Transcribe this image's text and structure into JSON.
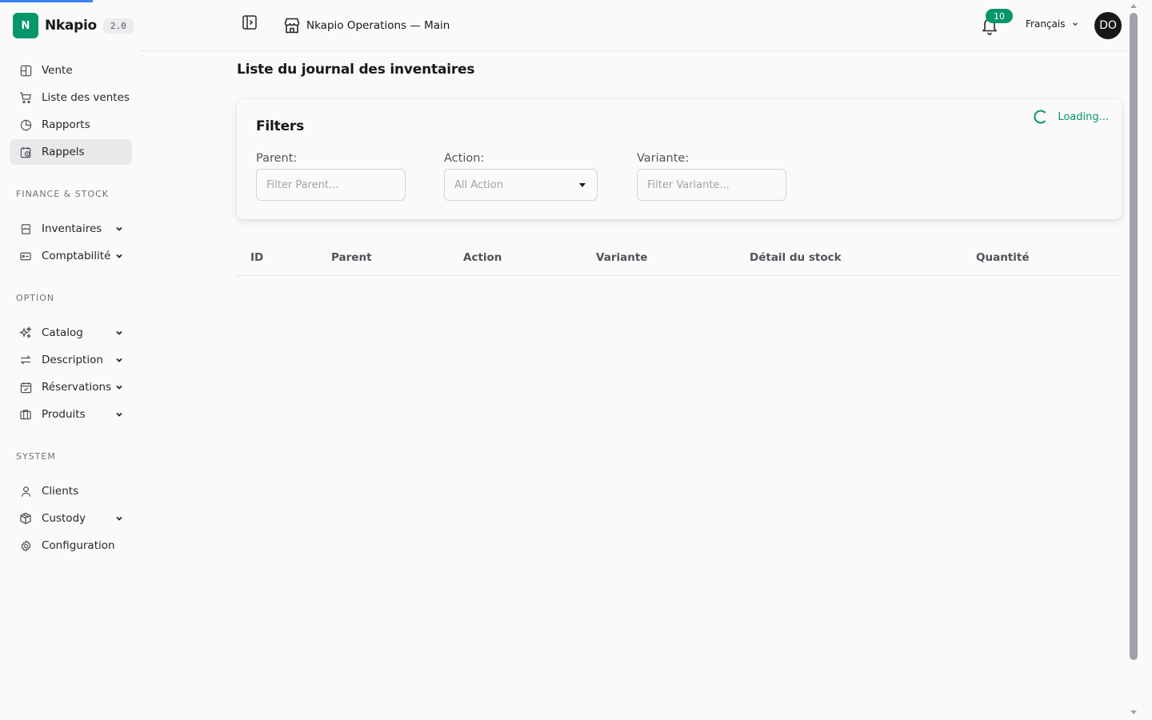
{
  "brand": {
    "logo_letter": "N",
    "name": "Nkapio",
    "version": "2.0"
  },
  "sidebar": {
    "items_top": [
      {
        "label": "Vente",
        "icon": "layout-grid-icon"
      },
      {
        "label": "Liste des ventes",
        "icon": "cart-icon"
      },
      {
        "label": "Rapports",
        "icon": "pie-chart-icon"
      },
      {
        "label": "Rappels",
        "icon": "calendar-clock-icon",
        "active": true
      }
    ],
    "section_finance": "FINANCE & STOCK",
    "items_finance": [
      {
        "label": "Inventaires",
        "icon": "store-icon"
      },
      {
        "label": "Comptabilité",
        "icon": "wallet-icon"
      }
    ],
    "section_option": "OPTION",
    "items_option": [
      {
        "label": "Catalog",
        "icon": "sparkles-icon"
      },
      {
        "label": "Description",
        "icon": "arrows-swap-icon"
      },
      {
        "label": "Réservations",
        "icon": "calendar-check-icon"
      },
      {
        "label": "Produits",
        "icon": "box-icon"
      }
    ],
    "section_system": "SYSTEM",
    "items_system": [
      {
        "label": "Clients",
        "icon": "user-icon"
      },
      {
        "label": "Custody",
        "icon": "package-icon"
      },
      {
        "label": "Configuration",
        "icon": "gear-icon"
      }
    ]
  },
  "header": {
    "store_name": "Nkapio Operations — Main",
    "notifications_count": "10",
    "language": "Français",
    "avatar_initials": "DO"
  },
  "page": {
    "title": "Liste du journal des inventaires"
  },
  "filters": {
    "title": "Filters",
    "loading_text": "Loading...",
    "parent_label": "Parent:",
    "parent_placeholder": "Filter Parent...",
    "action_label": "Action:",
    "action_value": "All Action",
    "variante_label": "Variante:",
    "variante_placeholder": "Filter Variante..."
  },
  "table": {
    "columns": [
      "ID",
      "Parent",
      "Action",
      "Variante",
      "Détail du stock",
      "Quantité"
    ]
  },
  "colors": {
    "accent": "#059669",
    "progress": "#3b82f6",
    "avatar_bg": "#18181b"
  }
}
